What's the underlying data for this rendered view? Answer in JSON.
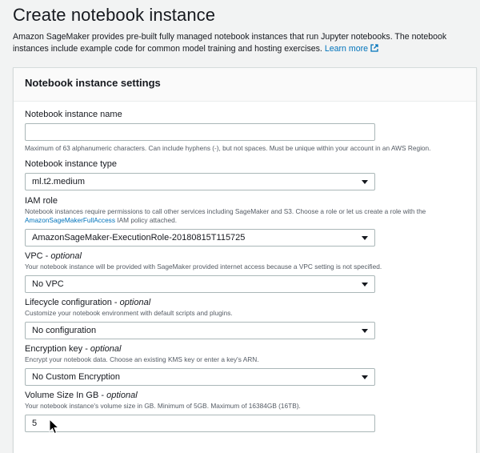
{
  "page": {
    "title": "Create notebook instance",
    "intro_text": "Amazon SageMaker provides pre-built fully managed notebook instances that run Jupyter notebooks. The notebook instances include example code for common model training and hosting exercises.",
    "learn_more_label": "Learn more"
  },
  "panel": {
    "title": "Notebook instance settings"
  },
  "fields": {
    "name": {
      "label": "Notebook instance name",
      "value": "",
      "help": "Maximum of 63 alphanumeric characters. Can include hyphens (-), but not spaces. Must be unique within your account in an AWS Region."
    },
    "instance_type": {
      "label": "Notebook instance type",
      "selected": "ml.t2.medium"
    },
    "iam_role": {
      "label": "IAM role",
      "help_before": "Notebook instances require permissions to call other services including SageMaker and S3. Choose a role or let us create a role with the",
      "help_link": "AmazonSageMakerFullAccess",
      "help_after": "IAM policy attached.",
      "selected": "AmazonSageMaker-ExecutionRole-20180815T115725"
    },
    "vpc": {
      "label": "VPC - ",
      "optional": "optional",
      "help": "Your notebook instance will be provided with SageMaker provided internet access because a VPC setting is not specified.",
      "selected": "No VPC"
    },
    "lifecycle": {
      "label": "Lifecycle configuration - ",
      "optional": "optional",
      "help": "Customize your notebook environment with default scripts and plugins.",
      "selected": "No configuration"
    },
    "encryption": {
      "label": "Encryption key - ",
      "optional": "optional",
      "help": "Encrypt your notebook data. Choose an existing KMS key or enter a key's ARN.",
      "selected": "No Custom Encryption"
    },
    "volume": {
      "label": "Volume Size In GB - ",
      "optional": "optional",
      "help": "Your notebook instance's volume size in GB. Minimum of 5GB. Maximum of 16384GB (16TB).",
      "value": "5"
    }
  },
  "colors": {
    "link": "#0073bb",
    "background": "#f2f3f3",
    "panel_header": "#fafafa"
  }
}
